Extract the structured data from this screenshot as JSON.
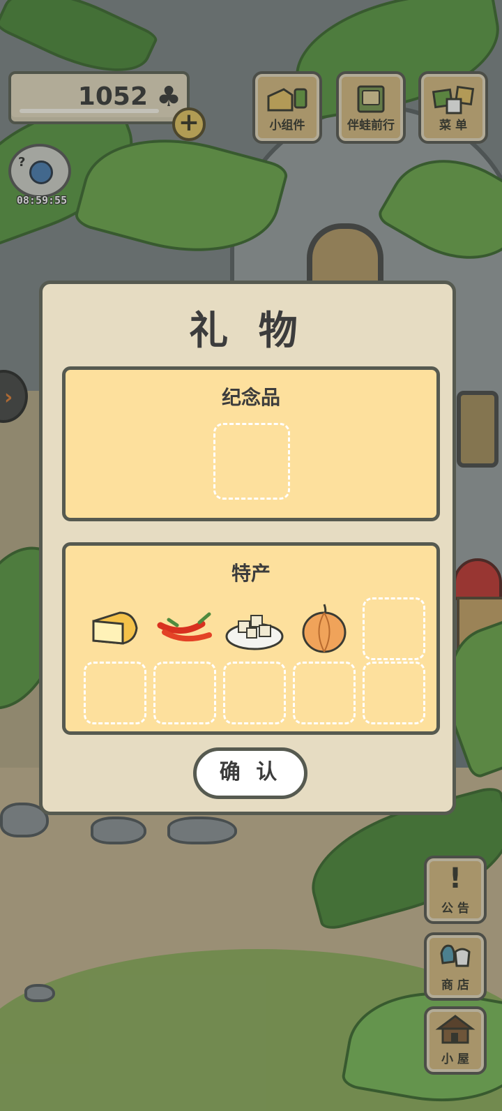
{
  "hud": {
    "clover_count": "1052",
    "clover_icon": "♣",
    "plus_label": "+",
    "visitor_timer": "08:59:55"
  },
  "top_menu": {
    "widget_label": "小组件",
    "travel_label": "伴蛙前行",
    "menu_label": "菜 单"
  },
  "side_menu": {
    "notice_label": "公 告",
    "notice_icon": "!",
    "shop_label": "商 店",
    "house_label": "小 屋"
  },
  "gift_dialog": {
    "title": "礼 物",
    "souvenir_title": "纪念品",
    "specialty_title": "特产",
    "specialty_items": [
      {
        "name": "cheese-icon"
      },
      {
        "name": "chili-pepper-icon"
      },
      {
        "name": "tofu-icon"
      },
      {
        "name": "onion-icon"
      }
    ],
    "empty_specialty_slots": 6,
    "confirm_label": "确 认"
  },
  "colors": {
    "panel_bg": "#fde09d",
    "dialog_bg": "#e6dcc2",
    "border": "#565a50"
  }
}
